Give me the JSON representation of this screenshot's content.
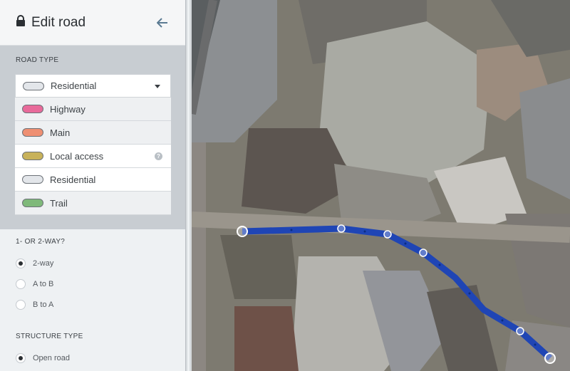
{
  "header": {
    "title": "Edit road"
  },
  "road_type": {
    "label": "ROAD TYPE",
    "selected": "Residential",
    "options": [
      {
        "label": "Highway",
        "color": "#e86a9a"
      },
      {
        "label": "Main",
        "color": "#ee8f72"
      },
      {
        "label": "Local access",
        "color": "#c8b25a",
        "help": "?"
      },
      {
        "label": "Residential",
        "color": "#e3e6ea"
      },
      {
        "label": "Trail",
        "color": "#7fb97a"
      }
    ]
  },
  "direction": {
    "label": "1- OR 2-WAY?",
    "options": [
      "2-way",
      "A to B",
      "B to A"
    ],
    "selected": "2-way"
  },
  "structure": {
    "label": "STRUCTURE TYPE",
    "options": [
      "Open road"
    ],
    "selected": "Open road"
  },
  "colors": {
    "route": "#1f45b5",
    "selected_swatch": "#e3e6ea"
  }
}
